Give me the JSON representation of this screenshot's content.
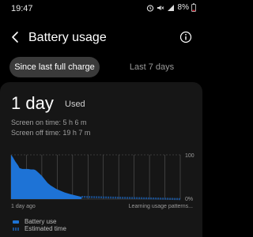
{
  "status_bar": {
    "time": "19:47",
    "battery_pct": "8%"
  },
  "header": {
    "title": "Battery usage"
  },
  "tabs": [
    {
      "label": "Since last full charge"
    },
    {
      "label": "Last 7 days"
    }
  ],
  "summary": {
    "used_value": "1 day",
    "used_label": "Used",
    "screen_on": "Screen on time: 5 h 6 m",
    "screen_off": "Screen off time: 19 h 7 m"
  },
  "chart_data": {
    "type": "area",
    "y_tick_labels": [
      "100",
      "0%"
    ],
    "x_tick_labels": [
      "1 day ago",
      "Learning usage patterns..."
    ],
    "ylim": [
      0,
      100
    ],
    "series": [
      {
        "name": "Battery use",
        "x": [
          0,
          1,
          3,
          5,
          6,
          7,
          8,
          9,
          10,
          12,
          14,
          16,
          17,
          18,
          20,
          22,
          23,
          24,
          25,
          26,
          28,
          30,
          32,
          35,
          38,
          42,
          46,
          50
        ],
        "values": [
          100,
          96,
          85,
          76,
          70,
          69,
          68,
          68,
          68,
          68,
          67,
          67,
          66,
          64,
          58,
          52,
          48,
          44,
          40,
          36,
          31,
          27,
          23,
          19,
          15,
          11,
          8,
          5
        ]
      },
      {
        "name": "Estimated time",
        "x": [
          50,
          120
        ],
        "values": [
          5,
          0
        ]
      }
    ],
    "colors": {
      "battery": "#1e73d6",
      "estimate": "#1a4f8f",
      "grid": "#5a5a5a"
    }
  },
  "legend": [
    {
      "label": "Battery use"
    },
    {
      "label": "Estimated time"
    }
  ]
}
